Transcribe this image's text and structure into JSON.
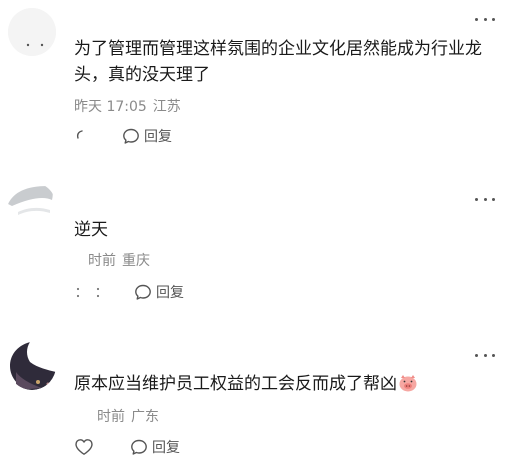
{
  "comments": [
    {
      "text": "为了管理而管理这样氛围的企业文化居然能成为行业龙头，真的没天理了",
      "time": "昨天 17:05",
      "location": "江苏",
      "reply_label": "回复"
    },
    {
      "text": "逆天",
      "time": "时前",
      "location": "重庆",
      "reply_label": "回复"
    },
    {
      "text": "原本应当维护员工权益的工会反而成了帮凶",
      "time": "时前",
      "location": "广东",
      "reply_label": "回复",
      "trailing_emoji": "pig-face-emoji"
    }
  ],
  "icons": {
    "more": "more-dots-icon",
    "like": "heart-outline-icon",
    "reply": "speech-bubble-icon"
  },
  "colors": {
    "text": "#1a1a1a",
    "meta": "#8a8a8a",
    "action": "#555555"
  }
}
